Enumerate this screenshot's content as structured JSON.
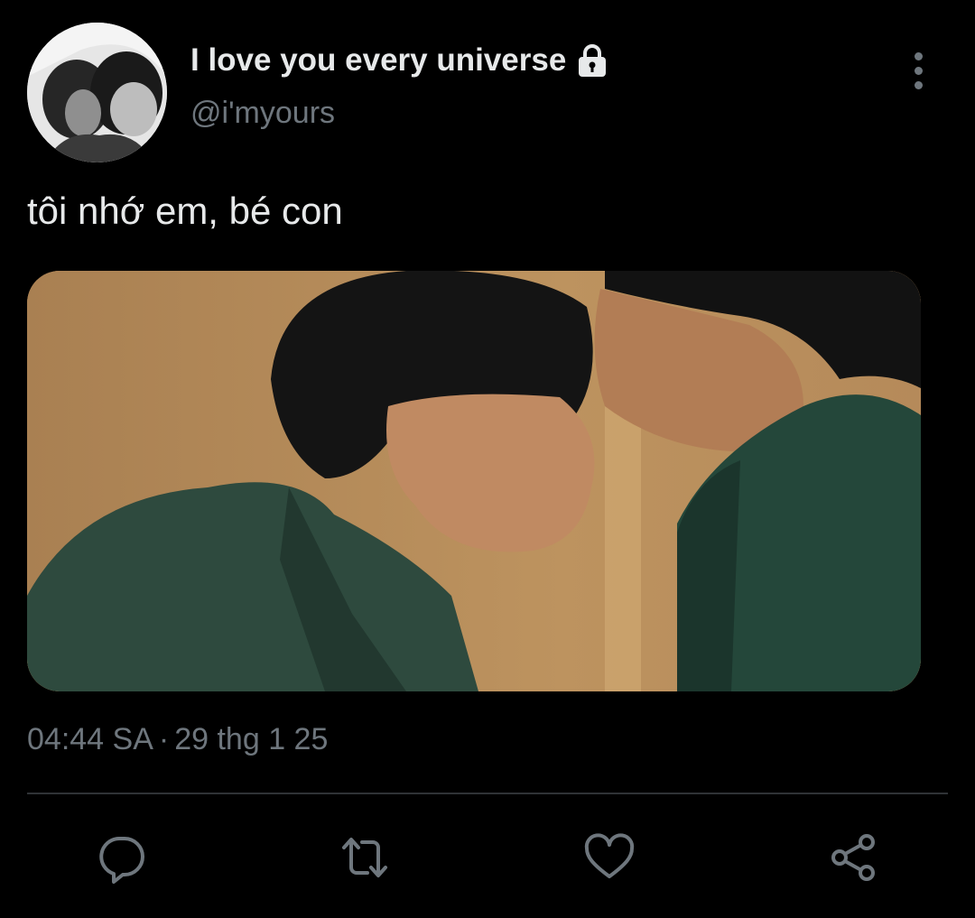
{
  "tweet": {
    "display_name": "I love you every universe",
    "handle": "@i'myours",
    "text": "tôi nhớ em, bé con",
    "time": "04:44 SA",
    "separator": "·",
    "date": "29 thg 1 25"
  },
  "icons": {
    "avatar": "profile-photo",
    "lock": "lock-icon",
    "more": "more-vertical-icon",
    "reply": "reply-icon",
    "retweet": "retweet-icon",
    "like": "heart-icon",
    "share": "share-icon"
  },
  "colors": {
    "background": "#000000",
    "primary_text": "#e7e9ea",
    "secondary_text": "#6e767d",
    "divider": "#2f3336"
  }
}
